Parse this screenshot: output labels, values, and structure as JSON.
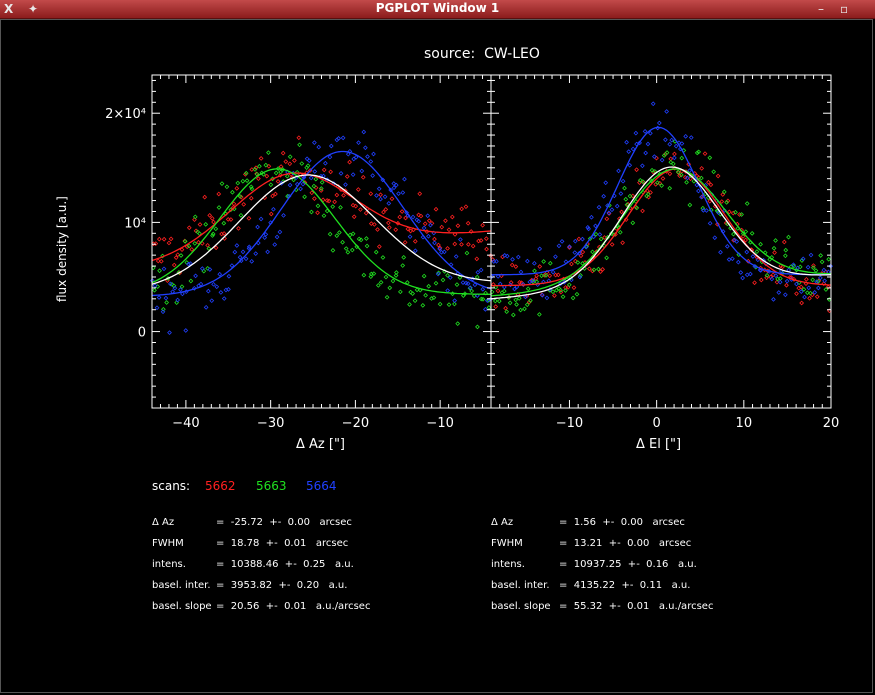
{
  "window": {
    "title": "PGPLOT Window 1",
    "close_icon": "X",
    "pin_icon": "pin",
    "minimize_icon": "-",
    "maximize_icon": "box"
  },
  "source_label": "source:  CW-LEO",
  "ylabel": "flux density [a.u.]",
  "colors": {
    "scan_5662": "#ff2020",
    "scan_5663": "#20e020",
    "scan_5664": "#2040ff",
    "fit_white": "#ffffff"
  },
  "chart_data": [
    {
      "type": "scatter",
      "panel": "left",
      "xlabel": "Δ Az [\"]",
      "ylabel": "flux density [a.u.]",
      "xlim": [
        -44,
        -4
      ],
      "ylim": [
        -7000,
        23500
      ],
      "xticks": [
        -40,
        -30,
        -20,
        -10
      ],
      "yticks": [
        {
          "v": 0,
          "label": "0"
        },
        {
          "v": 10000,
          "label": "10⁴"
        },
        {
          "v": 20000,
          "label": "2×10⁴"
        }
      ],
      "series": [
        {
          "name": "5662",
          "color": "#ff2020",
          "fit": {
            "base": 7300,
            "slope": 80,
            "amp": 7200,
            "center": -27.5,
            "fwhm": 17
          },
          "noise": 2600
        },
        {
          "name": "5663",
          "color": "#20e020",
          "fit": {
            "base": 3400,
            "slope": 0,
            "amp": 11500,
            "center": -29.2,
            "fwhm": 16
          },
          "noise": 2600
        },
        {
          "name": "5664",
          "color": "#2040ff",
          "fit": {
            "base": 3200,
            "slope": 0,
            "amp": 13300,
            "center": -21.5,
            "fwhm": 17
          },
          "noise": 2600
        }
      ],
      "white_fit": {
        "base": 3953.82,
        "slope": 20.56,
        "amp": 10388.46,
        "center": -25.72,
        "fwhm": 18.78
      }
    },
    {
      "type": "scatter",
      "panel": "right",
      "xlabel": "Δ El [\"]",
      "ylabel": "",
      "xlim": [
        -19,
        20
      ],
      "ylim": [
        -7000,
        23500
      ],
      "xticks": [
        -10,
        0,
        10,
        20
      ],
      "yticks": [],
      "series": [
        {
          "name": "5662",
          "color": "#ff2020",
          "fit": {
            "base": 4200,
            "slope": 0,
            "amp": 10700,
            "center": 2.3,
            "fwhm": 13
          },
          "noise": 2300
        },
        {
          "name": "5663",
          "color": "#20e020",
          "fit": {
            "base": 4300,
            "slope": 50,
            "amp": 10600,
            "center": 2.0,
            "fwhm": 14
          },
          "noise": 2300
        },
        {
          "name": "5664",
          "color": "#2040ff",
          "fit": {
            "base": 5200,
            "slope": 0,
            "amp": 13500,
            "center": 0.2,
            "fwhm": 11
          },
          "noise": 2300
        }
      ],
      "white_fit": {
        "base": 4135.22,
        "slope": 55.32,
        "amp": 10937.25,
        "center": 1.56,
        "fwhm": 13.21
      }
    }
  ],
  "scans": {
    "label": "scans:",
    "items": [
      "5662",
      "5663",
      "5664"
    ]
  },
  "stats_left": [
    {
      "name": "Δ Az",
      "value": "=  -25.72  +-  0.00   arcsec"
    },
    {
      "name": "FWHM",
      "value": "=  18.78  +-  0.01   arcsec"
    },
    {
      "name": "intens.",
      "value": "=  10388.46  +-  0.25   a.u."
    },
    {
      "name": "basel. inter.",
      "value": "=  3953.82  +-  0.20   a.u."
    },
    {
      "name": "basel. slope",
      "value": "=  20.56  +-  0.01   a.u./arcsec"
    }
  ],
  "stats_right": [
    {
      "name": "Δ Az",
      "value": "=  1.56  +-  0.00   arcsec"
    },
    {
      "name": "FWHM",
      "value": "=  13.21  +-  0.00   arcsec"
    },
    {
      "name": "intens.",
      "value": "=  10937.25  +-  0.16   a.u."
    },
    {
      "name": "basel. inter.",
      "value": "=  4135.22  +-  0.11   a.u."
    },
    {
      "name": "basel. slope",
      "value": "=  55.32  +-  0.01   a.u./arcsec"
    }
  ]
}
